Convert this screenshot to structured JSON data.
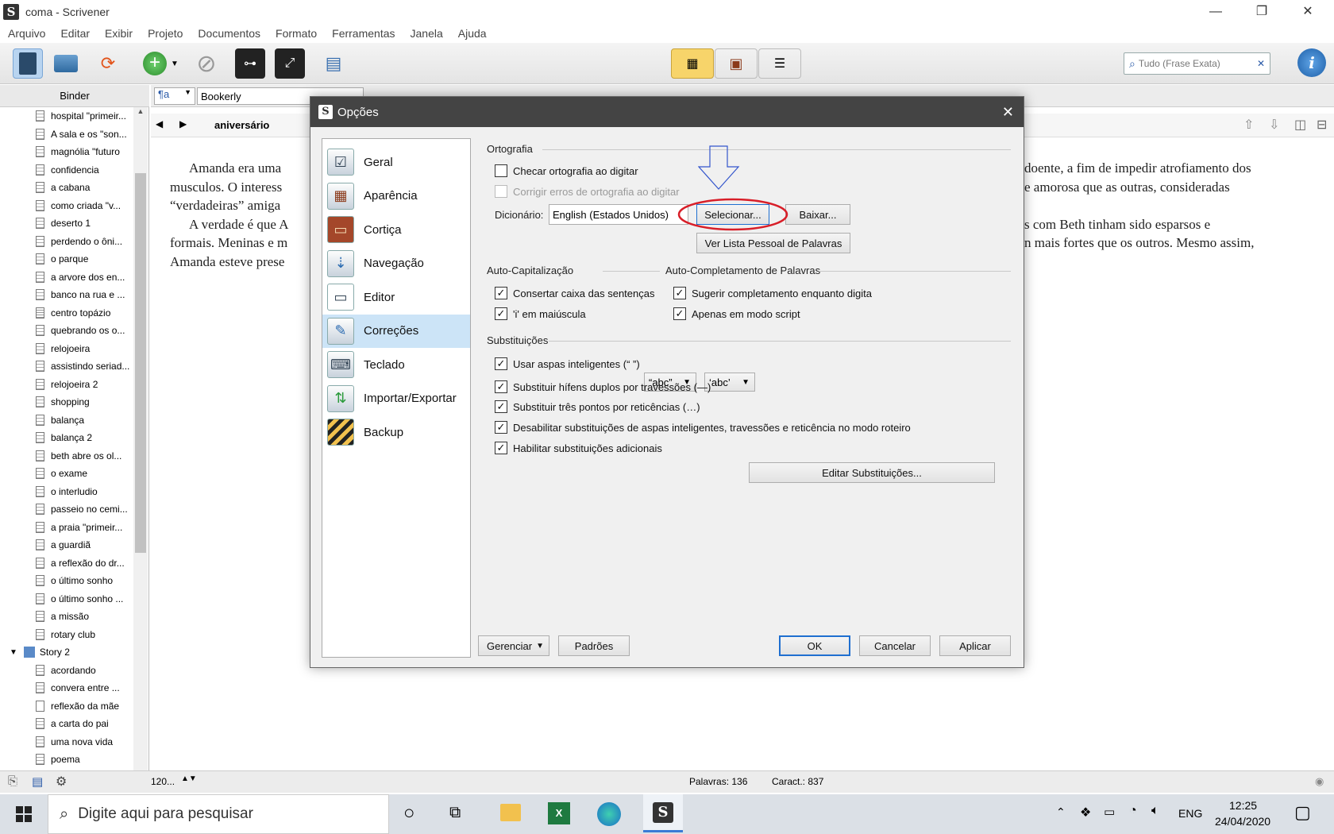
{
  "window": {
    "title": "coma - Scrivener"
  },
  "menu": [
    "Arquivo",
    "Editar",
    "Exibir",
    "Projeto",
    "Documentos",
    "Formato",
    "Ferramentas",
    "Janela",
    "Ajuda"
  ],
  "toolbar": {
    "search_placeholder": "Tudo (Frase Exata)"
  },
  "binder": {
    "header": "Binder",
    "items": [
      "hospital \"primeir...",
      "A sala e os \"son...",
      "magnólia \"futuro",
      "confidencia",
      "a cabana",
      "como criada \"v...",
      "deserto 1",
      "perdendo o ôni...",
      "o parque",
      "a arvore dos en...",
      "banco na rua e ...",
      "centro topázio",
      "quebrando os o...",
      "relojoeira",
      "assistindo seriad...",
      "relojoeira 2",
      "shopping",
      "balança",
      "balança 2",
      "beth abre os ol...",
      "o exame",
      "o interludio",
      "passeio no cemi...",
      "a praia \"primeir...",
      "a guardiã",
      "a reflexão do dr...",
      "o último sonho",
      "o último sonho ...",
      "a missão",
      "rotary club"
    ],
    "group": "Story 2",
    "group_items": [
      "acordando",
      "convera entre ...",
      "reflexão da mãe",
      "a carta do pai",
      "uma nova vida",
      "poema"
    ]
  },
  "format_bar": {
    "style": "¶a",
    "font": "Bookerly"
  },
  "editor": {
    "doc_title": "aniversário",
    "left_lines": [
      "Amanda era uma",
      "musculos. O interess",
      "“verdadeiras” amiga",
      "A verdade é que A",
      "formais. Meninas e m",
      "Amanda esteve prese"
    ],
    "right_lines": [
      "doente, a fim de impedir atrofiamento dos",
      "e amorosa que as outras, consideradas",
      "",
      "s com Beth tinham sido esparsos e",
      "n mais fortes que  os outros. Mesmo assim,",
      ""
    ]
  },
  "footer": {
    "zoom": "120...",
    "words": "Palavras: 136",
    "chars": "Caract.: 837"
  },
  "taskbar": {
    "search": "Digite aqui para pesquisar",
    "lang": "ENG",
    "time": "12:25",
    "date": "24/04/2020"
  },
  "dialog": {
    "title": "Opções",
    "nav": [
      "Geral",
      "Aparência",
      "Cortiça",
      "Navegação",
      "Editor",
      "Correções",
      "Teclado",
      "Importar/Exportar",
      "Backup"
    ],
    "ortografia": {
      "label": "Ortografia",
      "check_spelling": "Checar ortografia ao digitar",
      "fix_spelling": "Corrigir erros de ortografia ao digitar",
      "dict_label": "Dicionário:",
      "dict_value": "English (Estados Unidos)",
      "select_btn": "Selecionar...",
      "download_btn": "Baixar...",
      "word_list_btn": "Ver Lista Pessoal de Palavras"
    },
    "autocap": {
      "label": "Auto-Capitalização",
      "fix_case": "Consertar caixa das sentenças",
      "i_upper": "'i' em maiúscula"
    },
    "autocomplete": {
      "label": "Auto-Completamento de Palavras",
      "suggest": "Sugerir completamento enquanto digita",
      "script_only": "Apenas em modo script"
    },
    "subs": {
      "label": "Substituições",
      "smart_quotes": "Usar aspas inteligentes (“ ”)",
      "dq_value": "“abc”",
      "sq_value": "‘abc’",
      "dashes": "Substituir hífens duplos por travessões (—)",
      "ellipses": "Substituir três pontos por reticências (…)",
      "disable_script": "Desabilitar substituições de aspas inteligentes, travessões e reticência no modo roteiro",
      "extra": "Habilitar substituições adicionais",
      "edit_btn": "Editar Substituições..."
    },
    "buttons": {
      "manage": "Gerenciar",
      "defaults": "Padrões",
      "ok": "OK",
      "cancel": "Cancelar",
      "apply": "Aplicar"
    }
  },
  "colors": {
    "annotation_red": "#d81e28",
    "annotation_arrow": "#3355cc",
    "selection": "#cce4f7"
  }
}
